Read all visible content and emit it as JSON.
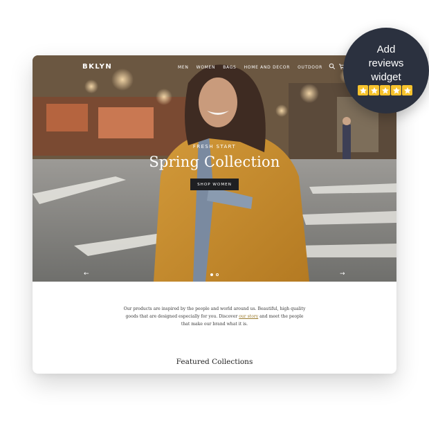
{
  "store": {
    "logo": "BKLYN",
    "nav": [
      "MEN",
      "WOMEN",
      "BAGS",
      "HOME AND DECOR",
      "OUTDOOR"
    ],
    "icons": [
      "search-icon",
      "cart-icon"
    ]
  },
  "hero": {
    "eyebrow": "FRESH START",
    "title": "Spring Collection",
    "button": "SHOP WOMEN",
    "prev_arrow": "←",
    "next_arrow": "→",
    "slides_total": 2,
    "active_slide": 1
  },
  "intro": {
    "line1": "Our products are inspired by the people and world around us. Beautiful, high quality",
    "line2_before": "goods that are designed especially for you. Discover",
    "line2_link": "our story",
    "line2_after": "and meet the people",
    "line3": "that make our brand what it is."
  },
  "featured": {
    "title": "Featured Collections"
  },
  "badge": {
    "line1": "Add",
    "line2": "reviews",
    "line3": "widget",
    "stars": 5
  },
  "colors": {
    "badge_bg": "#2b313f",
    "star": "#f7c32d",
    "button_bg": "#1e1f22",
    "link": "#9a7b2e"
  }
}
